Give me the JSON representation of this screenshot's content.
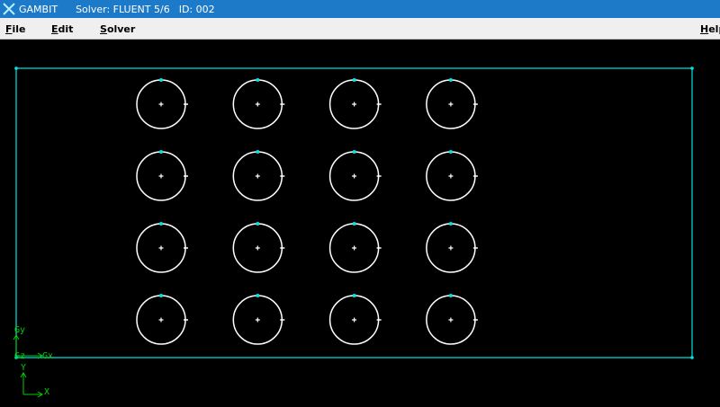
{
  "window": {
    "app_name": "GAMBIT",
    "solver": "Solver: FLUENT 5/6",
    "id": "ID: 002",
    "accent_color": "#1c7ac9"
  },
  "menu": {
    "items": [
      {
        "first": "F",
        "rest": "ile"
      },
      {
        "first": "E",
        "rest": "dit"
      },
      {
        "first": "S",
        "rest": "olver"
      }
    ],
    "help": {
      "first": "H",
      "rest": "elp"
    }
  },
  "viewport": {
    "background": "#000000",
    "boundary_color": "#00e5e5",
    "circle_color": "#ffffff",
    "vertex_color": "#00e5e5",
    "grid": {
      "rows": 4,
      "columns": 4
    },
    "axes": {
      "global_triad": {
        "y": "Gy",
        "z": "Gz",
        "x": "Gx"
      },
      "local_triad": {
        "y": "Y",
        "x": "X"
      },
      "color": "#00d000"
    }
  }
}
